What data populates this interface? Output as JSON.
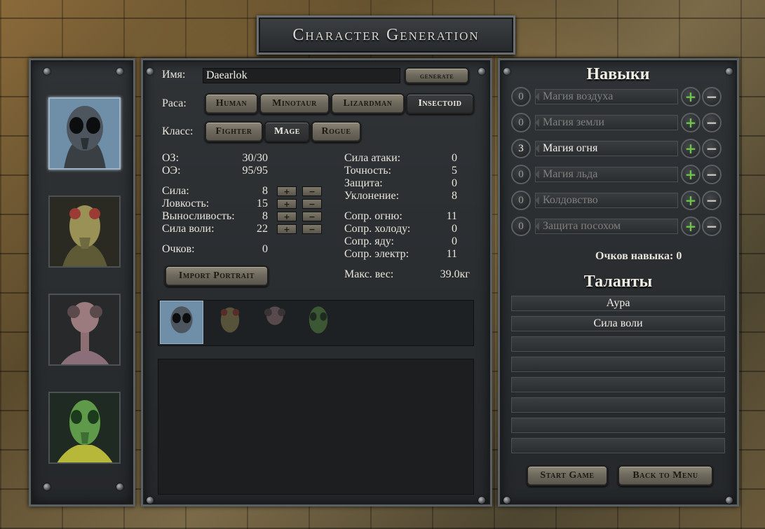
{
  "title": "Character Generation",
  "name": {
    "label": "Имя:",
    "value": "Daearlok",
    "generate": "generate"
  },
  "race": {
    "label": "Раса:",
    "options": [
      "Human",
      "Minotaur",
      "Lizardman",
      "Insectoid"
    ],
    "selected": "Insectoid"
  },
  "class": {
    "label": "Класс:",
    "options": [
      "Fighter",
      "Mage",
      "Rogue"
    ],
    "selected": "Mage"
  },
  "vitals": [
    {
      "label": "ОЗ:",
      "value": "30/30"
    },
    {
      "label": "ОЭ:",
      "value": "95/95"
    }
  ],
  "attributes": [
    {
      "label": "Сила:",
      "value": "8"
    },
    {
      "label": "Ловкость:",
      "value": "15"
    },
    {
      "label": "Выносливость:",
      "value": "8"
    },
    {
      "label": "Сила воли:",
      "value": "22"
    }
  ],
  "attr_buttons": {
    "plus": "+",
    "minus": "−"
  },
  "points": {
    "label": "Очков:",
    "value": "0"
  },
  "combat": [
    {
      "label": "Сила атаки:",
      "value": "0"
    },
    {
      "label": "Точность:",
      "value": "5"
    },
    {
      "label": "Защита:",
      "value": "0"
    },
    {
      "label": "Уклонение:",
      "value": "8"
    }
  ],
  "resist": [
    {
      "label": "Сопр. огню:",
      "value": "11"
    },
    {
      "label": "Сопр. холоду:",
      "value": "0"
    },
    {
      "label": "Сопр. яду:",
      "value": "0"
    },
    {
      "label": "Сопр. электр:",
      "value": "11"
    }
  ],
  "max_weight": {
    "label": "Макс. вес:",
    "value": "39.0кг"
  },
  "import_portrait": "Import Portrait",
  "skills": {
    "heading": "Навыки",
    "items": [
      {
        "value": "0",
        "name": "Магия воздуха"
      },
      {
        "value": "0",
        "name": "Магия земли"
      },
      {
        "value": "3",
        "name": "Магия огня"
      },
      {
        "value": "0",
        "name": "Магия льда"
      },
      {
        "value": "0",
        "name": "Колдовство"
      },
      {
        "value": "0",
        "name": "Защита посохом"
      }
    ],
    "points": "Очков навыка: 0"
  },
  "talents": {
    "heading": "Таланты",
    "items": [
      "Аура",
      "Сила воли",
      "",
      "",
      "",
      "",
      "",
      ""
    ]
  },
  "footer": {
    "start": "Start Game",
    "back": "Back to Menu"
  },
  "colors": {
    "accent_plus": "#6fc34a",
    "selected_border": "#9fb3c6"
  }
}
